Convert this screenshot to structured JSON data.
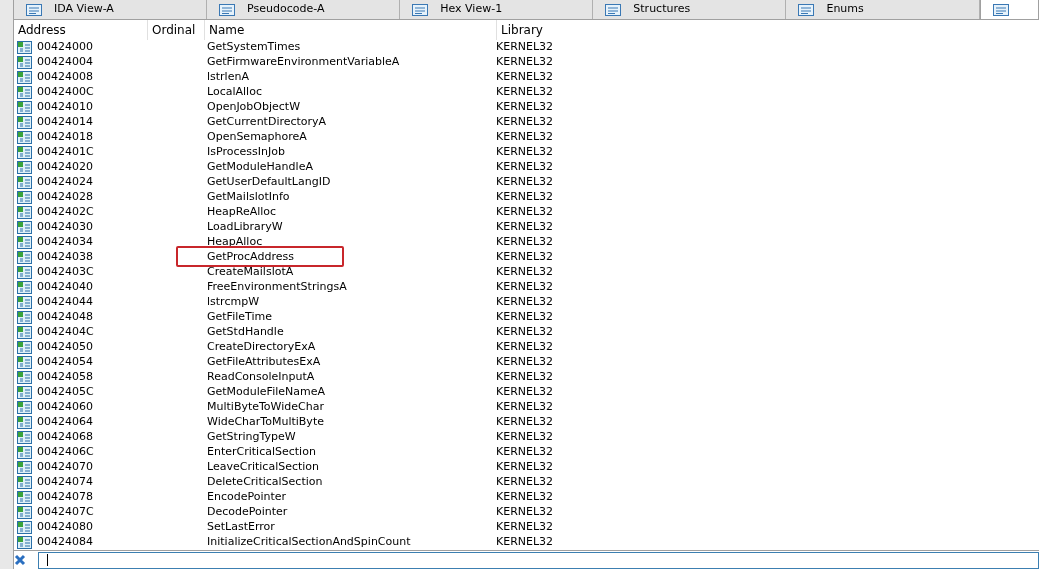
{
  "tabs": [
    {
      "label": "IDA View-A",
      "selected": false
    },
    {
      "label": "Pseudocode-A",
      "selected": false
    },
    {
      "label": "Hex View-1",
      "selected": false
    },
    {
      "label": "Structures",
      "selected": false
    },
    {
      "label": "Enums",
      "selected": false
    },
    {
      "selected": true
    }
  ],
  "table": {
    "columns": [
      "Address",
      "Ordinal",
      "Name",
      "Library"
    ],
    "rows": [
      {
        "address": "00424000",
        "name": "GetSystemTimes",
        "library": "KERNEL32",
        "highlighted": false
      },
      {
        "address": "00424004",
        "name": "GetFirmwareEnvironmentVariableA",
        "library": "KERNEL32",
        "highlighted": false
      },
      {
        "address": "00424008",
        "name": "lstrlenA",
        "library": "KERNEL32",
        "highlighted": false
      },
      {
        "address": "0042400C",
        "name": "LocalAlloc",
        "library": "KERNEL32",
        "highlighted": false
      },
      {
        "address": "00424010",
        "name": "OpenJobObjectW",
        "library": "KERNEL32",
        "highlighted": false
      },
      {
        "address": "00424014",
        "name": "GetCurrentDirectoryA",
        "library": "KERNEL32",
        "highlighted": false
      },
      {
        "address": "00424018",
        "name": "OpenSemaphoreA",
        "library": "KERNEL32",
        "highlighted": false
      },
      {
        "address": "0042401C",
        "name": "IsProcessInJob",
        "library": "KERNEL32",
        "highlighted": false
      },
      {
        "address": "00424020",
        "name": "GetModuleHandleA",
        "library": "KERNEL32",
        "highlighted": false
      },
      {
        "address": "00424024",
        "name": "GetUserDefaultLangID",
        "library": "KERNEL32",
        "highlighted": false
      },
      {
        "address": "00424028",
        "name": "GetMailslotInfo",
        "library": "KERNEL32",
        "highlighted": false
      },
      {
        "address": "0042402C",
        "name": "HeapReAlloc",
        "library": "KERNEL32",
        "highlighted": false
      },
      {
        "address": "00424030",
        "name": "LoadLibraryW",
        "library": "KERNEL32",
        "highlighted": false
      },
      {
        "address": "00424034",
        "name": "HeapAlloc",
        "library": "KERNEL32",
        "highlighted": false
      },
      {
        "address": "00424038",
        "name": "GetProcAddress",
        "library": "KERNEL32",
        "highlighted": true
      },
      {
        "address": "0042403C",
        "name": "CreateMailslotA",
        "library": "KERNEL32",
        "highlighted": false
      },
      {
        "address": "00424040",
        "name": "FreeEnvironmentStringsA",
        "library": "KERNEL32",
        "highlighted": false
      },
      {
        "address": "00424044",
        "name": "lstrcmpW",
        "library": "KERNEL32",
        "highlighted": false
      },
      {
        "address": "00424048",
        "name": "GetFileTime",
        "library": "KERNEL32",
        "highlighted": false
      },
      {
        "address": "0042404C",
        "name": "GetStdHandle",
        "library": "KERNEL32",
        "highlighted": false
      },
      {
        "address": "00424050",
        "name": "CreateDirectoryExA",
        "library": "KERNEL32",
        "highlighted": false
      },
      {
        "address": "00424054",
        "name": "GetFileAttributesExA",
        "library": "KERNEL32",
        "highlighted": false
      },
      {
        "address": "00424058",
        "name": "ReadConsoleInputA",
        "library": "KERNEL32",
        "highlighted": false
      },
      {
        "address": "0042405C",
        "name": "GetModuleFileNameA",
        "library": "KERNEL32",
        "highlighted": false
      },
      {
        "address": "00424060",
        "name": "MultiByteToWideChar",
        "library": "KERNEL32",
        "highlighted": false
      },
      {
        "address": "00424064",
        "name": "WideCharToMultiByte",
        "library": "KERNEL32",
        "highlighted": false
      },
      {
        "address": "00424068",
        "name": "GetStringTypeW",
        "library": "KERNEL32",
        "highlighted": false
      },
      {
        "address": "0042406C",
        "name": "EnterCriticalSection",
        "library": "KERNEL32",
        "highlighted": false
      },
      {
        "address": "00424070",
        "name": "LeaveCriticalSection",
        "library": "KERNEL32",
        "highlighted": false
      },
      {
        "address": "00424074",
        "name": "DeleteCriticalSection",
        "library": "KERNEL32",
        "highlighted": false
      },
      {
        "address": "00424078",
        "name": "EncodePointer",
        "library": "KERNEL32",
        "highlighted": false
      },
      {
        "address": "0042407C",
        "name": "DecodePointer",
        "library": "KERNEL32",
        "highlighted": false
      },
      {
        "address": "00424080",
        "name": "SetLastError",
        "library": "KERNEL32",
        "highlighted": false
      },
      {
        "address": "00424084",
        "name": "InitializeCriticalSectionAndSpinCount",
        "library": "KERNEL32",
        "highlighted": false
      }
    ]
  }
}
